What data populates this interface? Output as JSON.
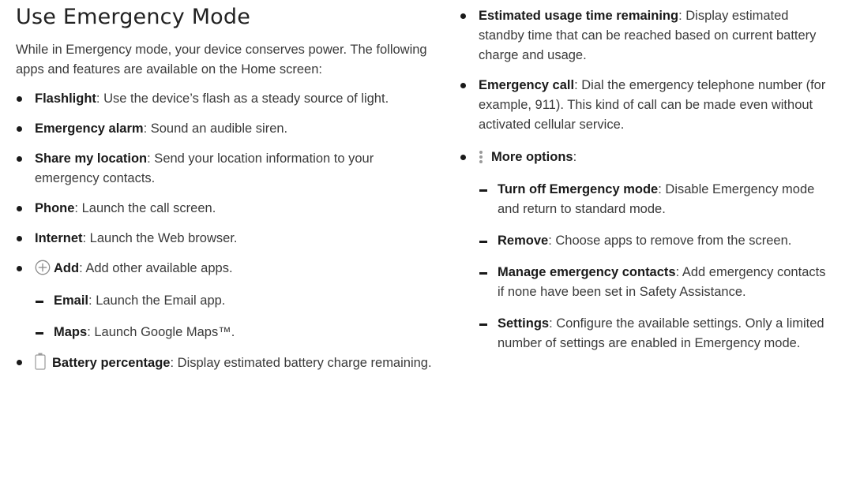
{
  "title": "Use Emergency Mode",
  "intro": "While in Emergency mode, your device conserves power. The following apps and features are available on the Home screen:",
  "left_items": [
    {
      "term": "Flashlight",
      "desc": ": Use the device’s flash as a steady source of light."
    },
    {
      "term": "Emergency alarm",
      "desc": ": Sound an audible siren."
    },
    {
      "term": "Share my location",
      "desc": ": Send your location information to your emergency contacts."
    },
    {
      "term": "Phone",
      "desc": ": Launch the call screen."
    },
    {
      "term": "Internet",
      "desc": ": Launch the Web browser."
    },
    {
      "term": "Add",
      "desc": ": Add other available apps.",
      "icon": "plus-circle-icon"
    },
    {
      "term": "Battery percentage",
      "desc": ": Display estimated battery charge remaining.",
      "icon": "battery-icon"
    }
  ],
  "add_subitems": [
    {
      "term": "Email",
      "desc": ": Launch the Email app."
    },
    {
      "term": "Maps",
      "desc": ": Launch Google Maps™."
    }
  ],
  "right_items": [
    {
      "term": "Estimated usage time remaining",
      "desc": ": Display estimated standby time that can be reached based on current battery charge and usage."
    },
    {
      "term": "Emergency call",
      "desc": ": Dial the emergency telephone number (for example, 911). This kind of call can be made even without activated cellular service."
    },
    {
      "term": "More options",
      "desc": ":",
      "icon": "more-options-icon"
    }
  ],
  "more_subitems": [
    {
      "term": "Turn off Emergency mode",
      "desc": ": Disable Emergency mode and return to standard mode."
    },
    {
      "term": "Remove",
      "desc": ": Choose apps to remove from the screen."
    },
    {
      "term": "Manage emergency contacts",
      "desc": ": Add emergency contacts if none have been set in Safety Assistance."
    },
    {
      "term": "Settings",
      "desc": ": Configure the available settings. Only a limited number of settings are enabled in Emergency mode."
    }
  ]
}
